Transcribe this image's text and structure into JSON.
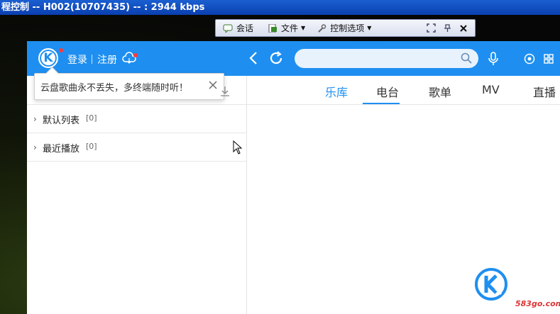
{
  "window_title": "程控制 -- H002(10707435) -- : 2944 kbps",
  "rdp_toolbar": {
    "items": [
      {
        "label": "会话",
        "icon": "chat-icon"
      },
      {
        "label": "文件",
        "icon": "file-icon",
        "dropdown": true
      },
      {
        "label": "控制选项",
        "icon": "wrench-icon",
        "dropdown": true
      }
    ],
    "right_icons": [
      "fullscreen-icon",
      "pin-icon",
      "close-icon"
    ]
  },
  "app": {
    "header": {
      "logo_letter": "K",
      "login": "登录",
      "register": "注册",
      "search_placeholder": ""
    },
    "nav_tabs": [
      {
        "label": "乐库",
        "active": true
      },
      {
        "label": "电台",
        "selected": true
      },
      {
        "label": "歌单"
      },
      {
        "label": "MV"
      },
      {
        "label": "直播"
      }
    ],
    "tooltip": {
      "text": "云盘歌曲永不丢失，多终端随时听！"
    },
    "playlists": [
      {
        "name": "默认列表",
        "count": "[0]"
      },
      {
        "name": "最近播放",
        "count": "[0]"
      }
    ]
  },
  "watermark": "583go.com",
  "colors": {
    "accent": "#1e8ff0",
    "badge": "#ff3a3a",
    "title_bar": "#1a5fd0"
  }
}
